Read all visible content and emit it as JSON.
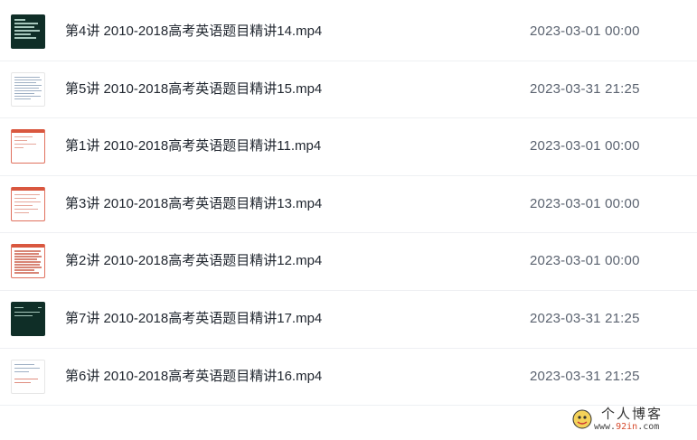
{
  "files": [
    {
      "name": "第4讲 2010-2018高考英语题目精讲14.mp4",
      "modified": "2023-03-01 00:00",
      "thumbnail": "dark-slide"
    },
    {
      "name": "第5讲 2010-2018高考英语题目精讲15.mp4",
      "modified": "2023-03-31 21:25",
      "thumbnail": "text-doc"
    },
    {
      "name": "第1讲 2010-2018高考英语题目精讲11.mp4",
      "modified": "2023-03-01 00:00",
      "thumbnail": "red-doc"
    },
    {
      "name": "第3讲 2010-2018高考英语题目精讲13.mp4",
      "modified": "2023-03-01 00:00",
      "thumbnail": "red-doc"
    },
    {
      "name": "第2讲 2010-2018高考英语题目精讲12.mp4",
      "modified": "2023-03-01 00:00",
      "thumbnail": "red-doc-dense"
    },
    {
      "name": "第7讲 2010-2018高考英语题目精讲17.mp4",
      "modified": "2023-03-31 21:25",
      "thumbnail": "dark-slide"
    },
    {
      "name": "第6讲 2010-2018高考英语题目精讲16.mp4",
      "modified": "2023-03-31 21:25",
      "thumbnail": "text-doc-red"
    }
  ],
  "watermark": {
    "title": "个人博客",
    "url_prefix": "www.",
    "url_accent": "92in",
    "url_suffix": ".com"
  },
  "colors": {
    "name_text": "#222831",
    "date_text": "#5b6370",
    "row_divider": "#eef0f3"
  }
}
